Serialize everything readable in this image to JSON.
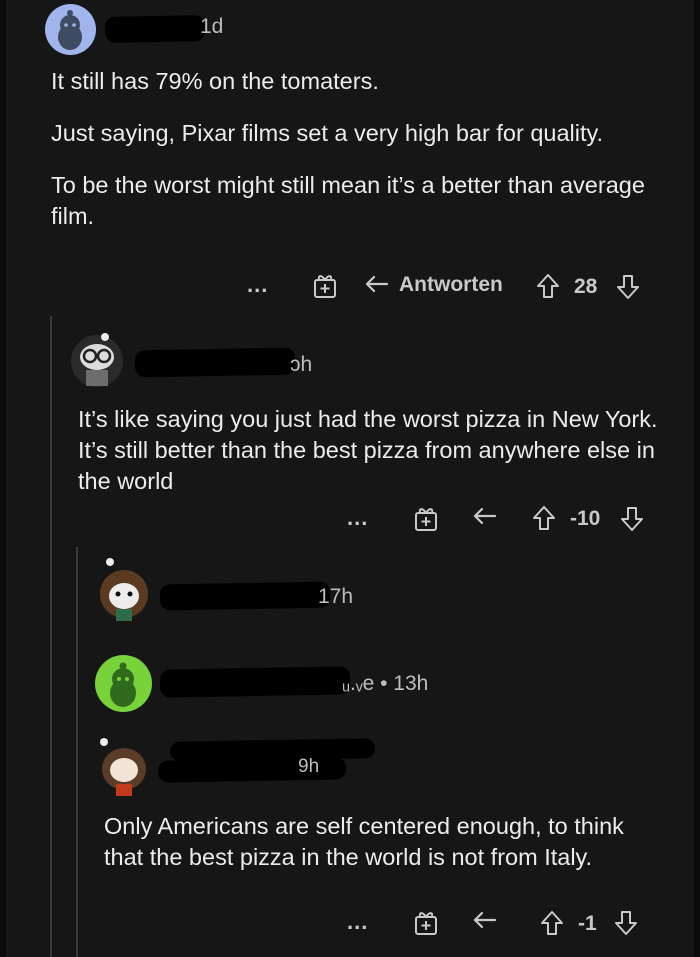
{
  "comment1": {
    "age": "1d",
    "paragraphs": [
      "It still has 79% on the tomaters.",
      "Just saying, Pixar films set a very high bar for quality.",
      "To be the worst might still mean it’s a better than average film."
    ],
    "more_label": "...",
    "reply_label": "Antworten",
    "score": "28",
    "avatar_color": "#9fb5ec"
  },
  "comment2": {
    "age": "ɔh",
    "text": "It’s like saying you just had the worst pizza in New York. It’s still better than the best pizza from anywhere else in the world",
    "more_label": "...",
    "score": "-10"
  },
  "comment3": {
    "age": "17h"
  },
  "comment4": {
    "age": "ᵤ.ᵥe • 13h",
    "avatar_color": "#78d23a"
  },
  "comment5": {
    "age": "9h",
    "text": "Only Americans are self centered enough, to think that the best pizza in the world is not from Italy.",
    "more_label": "...",
    "score": "-1"
  }
}
